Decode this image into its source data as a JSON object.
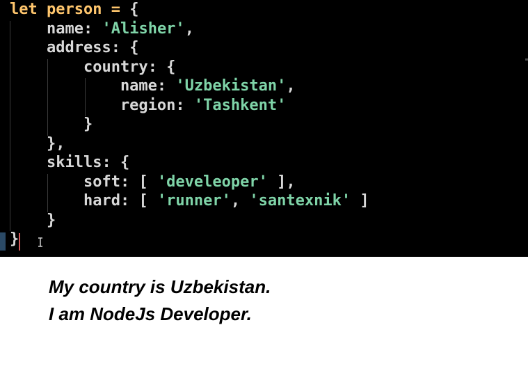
{
  "editor": {
    "lines": [
      [
        {
          "t": "let",
          "c": "kw"
        },
        {
          "t": " ",
          "c": "punc"
        },
        {
          "t": "person",
          "c": "ident"
        },
        {
          "t": " = ",
          "c": "op"
        },
        {
          "t": "{",
          "c": "punc"
        }
      ],
      [
        {
          "t": "    name",
          "c": "key"
        },
        {
          "t": ": ",
          "c": "punc"
        },
        {
          "t": "'Alisher'",
          "c": "str"
        },
        {
          "t": ",",
          "c": "punc"
        }
      ],
      [
        {
          "t": "    address",
          "c": "key"
        },
        {
          "t": ": {",
          "c": "punc"
        }
      ],
      [
        {
          "t": "        country",
          "c": "key"
        },
        {
          "t": ": {",
          "c": "punc"
        }
      ],
      [
        {
          "t": "            name",
          "c": "key"
        },
        {
          "t": ": ",
          "c": "punc"
        },
        {
          "t": "'Uzbekistan'",
          "c": "str"
        },
        {
          "t": ",",
          "c": "punc"
        }
      ],
      [
        {
          "t": "            region",
          "c": "key"
        },
        {
          "t": ": ",
          "c": "punc"
        },
        {
          "t": "'Tashkent'",
          "c": "str"
        }
      ],
      [
        {
          "t": "        }",
          "c": "punc"
        }
      ],
      [
        {
          "t": "    },",
          "c": "punc"
        }
      ],
      [
        {
          "t": "    skills",
          "c": "key"
        },
        {
          "t": ": {",
          "c": "punc"
        }
      ],
      [
        {
          "t": "        soft",
          "c": "key"
        },
        {
          "t": ": [ ",
          "c": "punc"
        },
        {
          "t": "'develeoper'",
          "c": "str"
        },
        {
          "t": " ],",
          "c": "punc"
        }
      ],
      [
        {
          "t": "        hard",
          "c": "key"
        },
        {
          "t": ": [ ",
          "c": "punc"
        },
        {
          "t": "'runner'",
          "c": "str"
        },
        {
          "t": ", ",
          "c": "punc"
        },
        {
          "t": "'santexnik'",
          "c": "str"
        },
        {
          "t": " ]",
          "c": "punc"
        }
      ],
      [
        {
          "t": "    }",
          "c": "punc"
        }
      ],
      [
        {
          "t": "}",
          "c": "punc"
        }
      ]
    ]
  },
  "caption": {
    "line1": "My country is Uzbekistan.",
    "line2": "I am NodeJs Developer."
  }
}
